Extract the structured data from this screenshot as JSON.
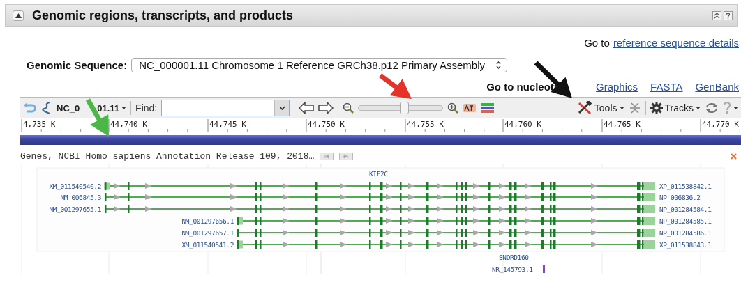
{
  "section": {
    "title": "Genomic regions, transcripts, and products",
    "expanded": true
  },
  "reference_link": {
    "prefix": "Go to",
    "link": "reference sequence details"
  },
  "genomic_sequence": {
    "label": "Genomic Sequence:",
    "value": "NC_000001.11 Chromosome 1 Reference GRCh38.p12 Primary Assembly"
  },
  "nucleotide_links": {
    "prefix": "Go to nucleoti",
    "links": [
      "Graphics",
      "FASTA",
      "GenBank"
    ]
  },
  "toolbar": {
    "sequence_label_parts": [
      "NC_0",
      "01.11"
    ],
    "find_label": "Find:",
    "zoom": {
      "level": 0.55
    },
    "tools": "Tools",
    "tracks": "Tracks"
  },
  "ruler": [
    "4,735 K",
    "44,740 K",
    "44,745 K",
    "44,750 K",
    "44,755 K",
    "44,760 K",
    "44,765 K",
    "44,770 K"
  ],
  "track": {
    "title": "Genes, NCBI Homo sapiens Annotation Release 109, 2018…",
    "gene": "KIF2C",
    "transcripts": [
      {
        "name": "XM_011540540.2",
        "product": "XP_011538842.1",
        "kind": "full",
        "utr_start": true
      },
      {
        "name": "NM_006845.3",
        "product": "NP_006836.2",
        "kind": "full",
        "utr_start": false
      },
      {
        "name": "NM_001297655.1",
        "product": "NP_001284584.1",
        "kind": "full",
        "utr_start": false
      },
      {
        "name": "NM_001297656.1",
        "product": "NP_001284585.1",
        "kind": "partial",
        "utr_start": true
      },
      {
        "name": "NM_001297657.1",
        "product": "NP_001284586.1",
        "kind": "partial",
        "utr_start": false
      },
      {
        "name": "XM_011540541.2",
        "product": "XP_011538843.1",
        "kind": "partial",
        "utr_start": true
      }
    ],
    "rna_gene": "SNORD160",
    "rna_transcript": "NR_145793.1"
  },
  "annotation_arrows": [
    {
      "color": "#4cb748"
    },
    {
      "color": "#e5332a"
    },
    {
      "color": "#111111"
    }
  ]
}
